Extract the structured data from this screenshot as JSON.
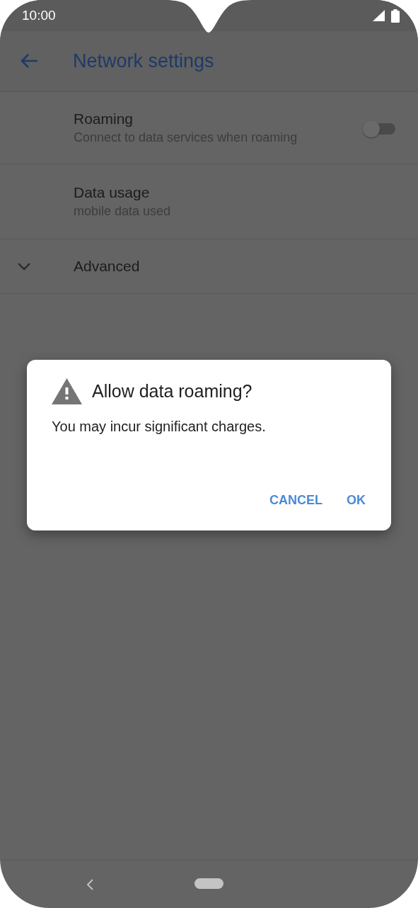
{
  "status_bar": {
    "time": "10:00"
  },
  "app_bar": {
    "title": "Network settings"
  },
  "settings": [
    {
      "kind": "toggle",
      "title": "Roaming",
      "summary": "Connect to data services when roaming",
      "on": false
    },
    {
      "kind": "plain",
      "title": "Data usage",
      "summary": "mobile data used"
    },
    {
      "kind": "expander",
      "title": "Advanced",
      "expanded": false
    }
  ],
  "dialog": {
    "title": "Allow data roaming?",
    "message": "You may incur significant charges.",
    "buttons": [
      "CANCEL",
      "OK"
    ]
  }
}
